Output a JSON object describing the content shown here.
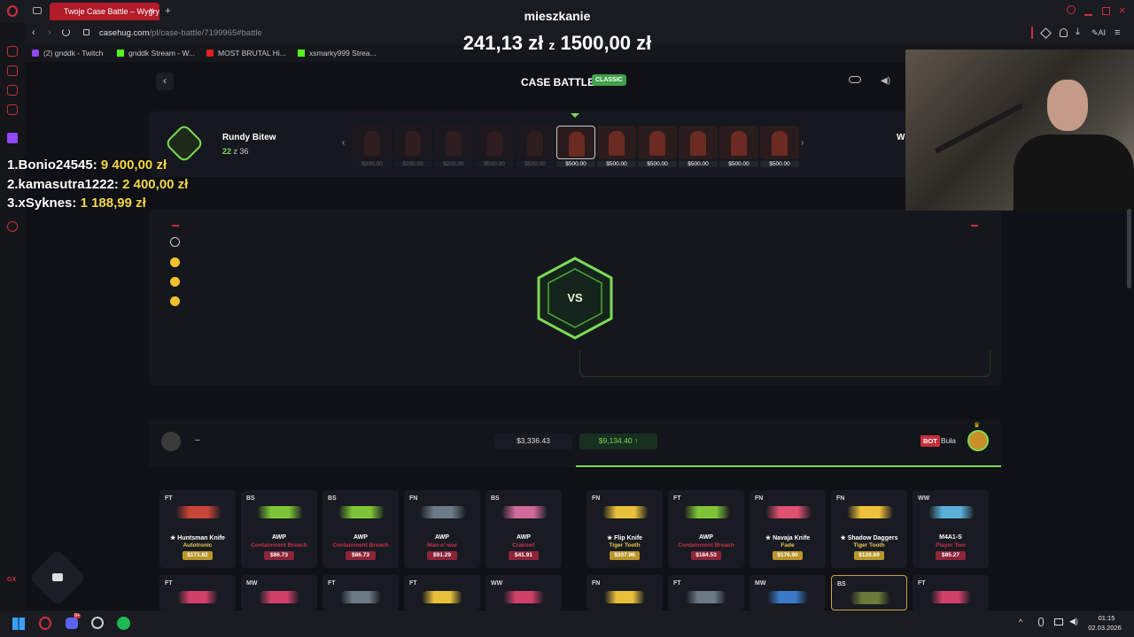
{
  "browser": {
    "tab_title": "Twoje Case Battle – Wygry",
    "url_domain": "casehug.com",
    "url_path": "/pl/case-battle/7199965#battle",
    "bookmarks": [
      "(2) gnddk - Twitch",
      "gnddk Stream - W...",
      "MOST BRUTAL Hi...",
      "xsmarky999 Strea..."
    ],
    "ai_label": "AI"
  },
  "overlay": {
    "goal_title": "mieszkanie",
    "goal_current": "241,13 zł",
    "goal_sep": "z",
    "goal_target": "1500,00 zł",
    "leaderboard": [
      {
        "rank": "1.",
        "name": "Bonio24545:",
        "amount": "9 400,00 zł"
      },
      {
        "rank": "2.",
        "name": "kamasutra1222:",
        "amount": "2 400,00 zł"
      },
      {
        "rank": "3.",
        "name": "xSyknes:",
        "amount": "1 188,99 zł"
      }
    ]
  },
  "page": {
    "title": "CASE BATTLE",
    "mode_badge": "CLASSIC",
    "rounds_label": "Rundy Bitew",
    "rounds_current": "22",
    "rounds_of": "z 36",
    "partial_label": "W",
    "case_prices": [
      "$200.00",
      "$200.00",
      "$200.00",
      "$500.00",
      "$500.00",
      "$500.00",
      "$500.00",
      "$500.00",
      "$500.00",
      "$500.00",
      "$500.00"
    ],
    "vs_label": "VS",
    "player_left_name": "–",
    "player_left_total": "$3,336.43",
    "player_right_total": "$9,134.40",
    "bot_badge": "BOT",
    "bot_name": "Buła"
  },
  "items_row1": [
    {
      "cond": "FT",
      "name": "★ Huntsman Knife",
      "skin": "Autotronic",
      "price": "$171.82",
      "skin_color": "#f0c94a",
      "price_bg": "#b8962a",
      "gun": "#c9453a"
    },
    {
      "cond": "BS",
      "name": "AWP",
      "skin": "Containment Breach",
      "price": "$86.73",
      "skin_color": "#c8304a",
      "price_bg": "#8e2438",
      "gun": "#7fc437"
    },
    {
      "cond": "BS",
      "name": "AWP",
      "skin": "Containment Breach",
      "price": "$86.73",
      "skin_color": "#c8304a",
      "price_bg": "#8e2438",
      "gun": "#7fc437"
    },
    {
      "cond": "FN",
      "name": "AWP",
      "skin": "Man-o'-war",
      "price": "$91.29",
      "skin_color": "#c8304a",
      "price_bg": "#8e2438",
      "gun": "#6c7a86"
    },
    {
      "cond": "BS",
      "name": "AWP",
      "skin": "Crakow!",
      "price": "$41.91",
      "skin_color": "#c8304a",
      "price_bg": "#8e2438",
      "gun": "#d06a9a"
    },
    {
      "cond": "FN",
      "name": "★ Flip Knife",
      "skin": "Tiger Tooth",
      "price": "$337.96",
      "skin_color": "#f0c94a",
      "price_bg": "#b8962a",
      "gun": "#e8c03a"
    },
    {
      "cond": "FT",
      "name": "AWP",
      "skin": "Containment Breach",
      "price": "$184.53",
      "skin_color": "#c8304a",
      "price_bg": "#8e2438",
      "gun": "#7fc437"
    },
    {
      "cond": "FN",
      "name": "★ Navaja Knife",
      "skin": "Fade",
      "price": "$176.90",
      "skin_color": "#f0c94a",
      "price_bg": "#b8962a",
      "gun": "#e05070"
    },
    {
      "cond": "FN",
      "name": "★ Shadow Daggers",
      "skin": "Tiger Tooth",
      "price": "$128.69",
      "skin_color": "#f0c94a",
      "price_bg": "#b8962a",
      "gun": "#f0c03a"
    },
    {
      "cond": "WW",
      "name": "M4A1-S",
      "skin": "Player Two",
      "price": "$85.27",
      "skin_color": "#c8304a",
      "price_bg": "#8e2438",
      "gun": "#5ab0d8"
    }
  ],
  "items_row2": [
    {
      "cond": "FT",
      "gun": "#d0406a"
    },
    {
      "cond": "MW",
      "gun": "#d0406a"
    },
    {
      "cond": "FT",
      "gun": "#6c7a86"
    },
    {
      "cond": "FT",
      "gun": "#e8c03a"
    },
    {
      "cond": "WW",
      "gun": "#d0406a"
    },
    {
      "cond": "FN",
      "gun": "#e8c03a"
    },
    {
      "cond": "FT",
      "gun": "#6c7a86"
    },
    {
      "cond": "MW",
      "gun": "#3a7ac8"
    },
    {
      "cond": "BS",
      "gun": "#6a7a3a"
    },
    {
      "cond": "FT",
      "gun": "#d0406a"
    }
  ],
  "taskbar": {
    "time": "01:15",
    "date": "02.03.2026",
    "notif_badge": "9+"
  }
}
